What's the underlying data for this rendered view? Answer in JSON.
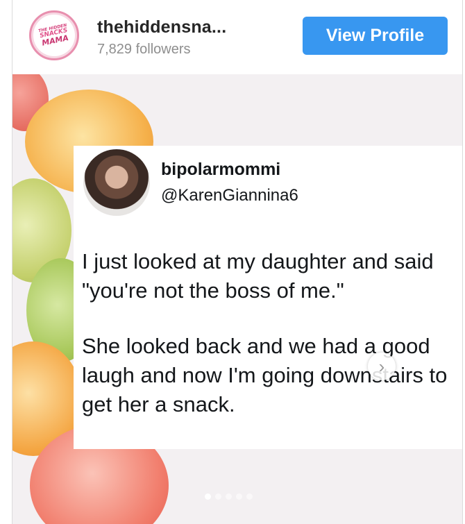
{
  "profile": {
    "username": "thehiddensna...",
    "followers": "7,829 followers",
    "view_profile_label": "View Profile",
    "logo_lines": [
      "THE HIDDEN",
      "SNACKS",
      "MAMA"
    ]
  },
  "tweet": {
    "name": "bipolarmommi",
    "handle": "@KarenGiannina6",
    "paragraph1": "I just looked at my daughter and said \"you're not the boss of me.\"",
    "paragraph2": "She looked back and we had a good laugh and now I'm going downstairs to get her a snack."
  },
  "carousel": {
    "next_icon": "chevron-right-icon",
    "slide_count": 5,
    "active_index": 0
  },
  "colors": {
    "button": "#3897f0",
    "username": "#262626",
    "followers": "#8e8e8e"
  }
}
